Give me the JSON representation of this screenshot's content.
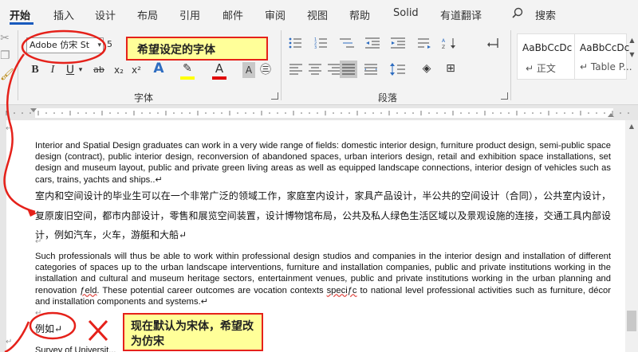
{
  "menu": {
    "tabs": [
      "开始",
      "插入",
      "设计",
      "布局",
      "引用",
      "邮件",
      "审阅",
      "视图",
      "帮助",
      "Solid",
      "有道翻译"
    ],
    "search_label": "搜索"
  },
  "ribbon": {
    "font_name": "Adobe 仿宋 St",
    "font_size_fragment": "5",
    "font_group_label": "字体",
    "paragraph_group_label": "段落",
    "styles": [
      {
        "sample": "AaBbCcDc",
        "name": "↵ 正文"
      },
      {
        "sample": "AaBbCcDc",
        "name": "↵ Table P..."
      }
    ]
  },
  "document": {
    "para1": "Interior and Spatial Design graduates can work in a very wide range of fields: domestic interior design, furniture product design, semi-public space design (contract), public interior design, reconversion of abandoned spaces, urban interiors design, retail and exhibition space installations, set design and museum layout, public and private green living areas as well as equipped landscape connections, interior design of vehicles such as cars, trains, yachts and ships..↵",
    "para2": "室内和空间设计的毕业生可以在一个非常广泛的领域工作，家庭室内设计，家具产品设计，半公共的空间设计（合同），公共室内设计，复原废旧空间，都市内部设计，零售和展览空间装置，设计博物馆布局，公共及私人绿色生活区域以及景观设施的连接，交通工具内部设计，例如汽车，火车，游艇和大船↵",
    "para3_before": "Such professionals will thus be able to work within professional design studios and companies in the interior design and installation of different categories of spaces up to the urban landscape interventions, furniture and installation companies, public and private institutions working in the installation and cultural and museum heritage sectors, entertainment venues, public and private institutions working in the  urban planning and renovation ",
    "para3_typo1": "ƒeld",
    "para3_middle": ". These potential career outcomes are vocation contexts ",
    "para3_typo2": "speciƒc",
    "para3_after": " to national level professional activities  such as furniture, décor and installation components and systems.↵",
    "example_text": "例如↵",
    "cut_line": "Survey of Universit..."
  },
  "annotations": {
    "callout_font": "希望设定的字体",
    "callout_default": "现在默认为宋体，希望改为仿宋"
  },
  "colors": {
    "accent": "#185abd",
    "annotation_red": "#e5211a",
    "callout_fill": "#ffff99"
  }
}
